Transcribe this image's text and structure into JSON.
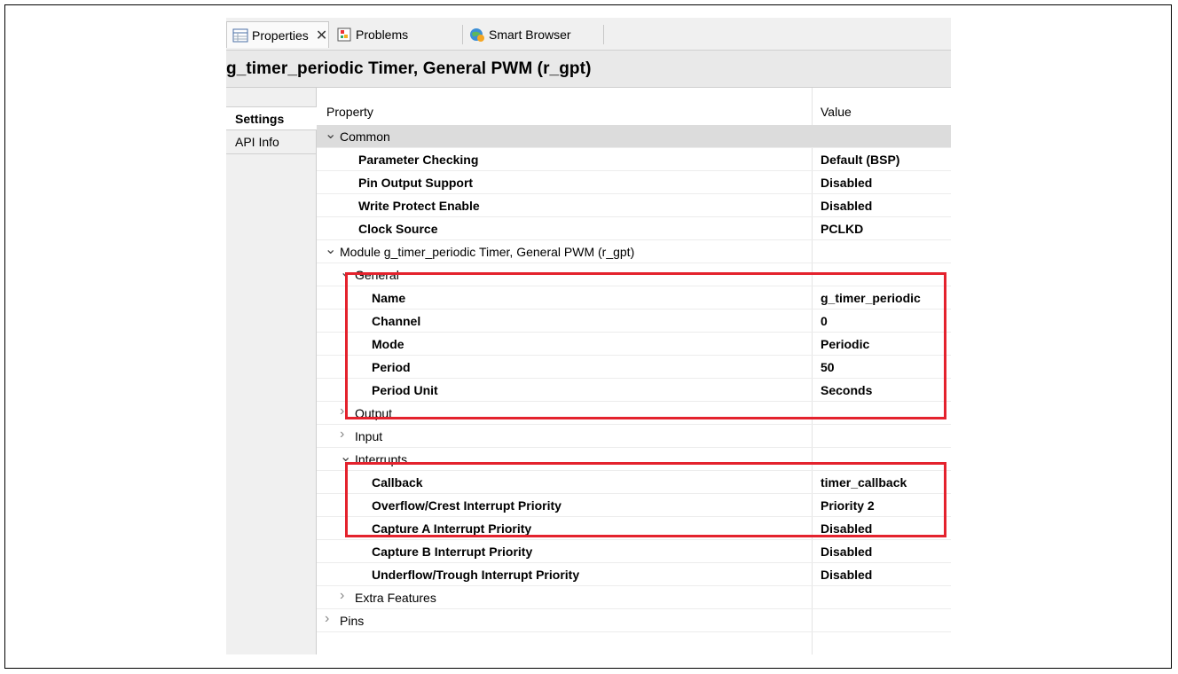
{
  "tabs": [
    {
      "label": "Properties",
      "icon": "properties-icon",
      "active": true
    },
    {
      "label": "Problems",
      "icon": "problems-icon",
      "active": false
    },
    {
      "label": "Smart Browser",
      "icon": "smart-browser-icon",
      "active": false
    }
  ],
  "title": "g_timer_periodic Timer, General PWM (r_gpt)",
  "side_tabs": [
    "Settings",
    "API Info"
  ],
  "columns": {
    "property": "Property",
    "value": "Value"
  },
  "rows": [
    {
      "name": "Common",
      "value": "",
      "expander": "expanded",
      "level": 0,
      "bold": false
    },
    {
      "name": "Parameter Checking",
      "value": "Default (BSP)",
      "expander": "none",
      "level": 1,
      "bold": true
    },
    {
      "name": "Pin Output Support",
      "value": "Disabled",
      "expander": "none",
      "level": 1,
      "bold": true
    },
    {
      "name": "Write Protect Enable",
      "value": "Disabled",
      "expander": "none",
      "level": 1,
      "bold": true
    },
    {
      "name": "Clock Source",
      "value": "PCLKD",
      "expander": "none",
      "level": 1,
      "bold": true
    },
    {
      "name": "Module g_timer_periodic Timer, General PWM (r_gpt)",
      "value": "",
      "expander": "expanded",
      "level": 0,
      "bold": false
    },
    {
      "name": "General",
      "value": "",
      "expander": "expanded",
      "level": 1,
      "bold": false
    },
    {
      "name": "Name",
      "value": "g_timer_periodic",
      "expander": "none",
      "level": 2,
      "bold": true
    },
    {
      "name": "Channel",
      "value": "0",
      "expander": "none",
      "level": 2,
      "bold": true
    },
    {
      "name": "Mode",
      "value": "Periodic",
      "expander": "none",
      "level": 2,
      "bold": true
    },
    {
      "name": "Period",
      "value": "50",
      "expander": "none",
      "level": 2,
      "bold": true
    },
    {
      "name": "Period Unit",
      "value": "Seconds",
      "expander": "none",
      "level": 2,
      "bold": true
    },
    {
      "name": "Output",
      "value": "",
      "expander": "collapsed",
      "level": 1,
      "bold": false
    },
    {
      "name": "Input",
      "value": "",
      "expander": "collapsed",
      "level": 1,
      "bold": false
    },
    {
      "name": "Interrupts",
      "value": "",
      "expander": "expanded",
      "level": 1,
      "bold": false
    },
    {
      "name": "Callback",
      "value": "timer_callback",
      "expander": "none",
      "level": 2,
      "bold": true
    },
    {
      "name": "Overflow/Crest Interrupt Priority",
      "value": "Priority 2",
      "expander": "none",
      "level": 2,
      "bold": true
    },
    {
      "name": "Capture A Interrupt Priority",
      "value": "Disabled",
      "expander": "none",
      "level": 2,
      "bold": true
    },
    {
      "name": "Capture B Interrupt Priority",
      "value": "Disabled",
      "expander": "none",
      "level": 2,
      "bold": true
    },
    {
      "name": "Underflow/Trough Interrupt Priority",
      "value": "Disabled",
      "expander": "none",
      "level": 2,
      "bold": true
    },
    {
      "name": "Extra Features",
      "value": "",
      "expander": "collapsed",
      "level": 1,
      "bold": false
    },
    {
      "name": "Pins",
      "value": "",
      "expander": "collapsed",
      "level": 0,
      "bold": false
    }
  ],
  "highlight_color": "#e4222d"
}
